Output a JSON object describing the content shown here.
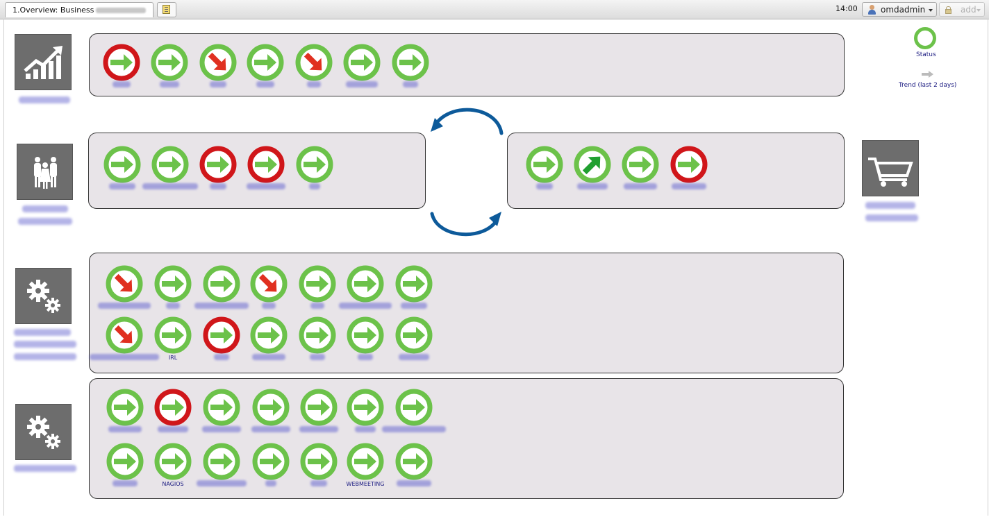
{
  "topbar": {
    "tab_label": "1.Overview: Business",
    "clock": "14:00",
    "user": "omdadmin",
    "add_label": "add"
  },
  "legend": {
    "status_label": "Status",
    "trend_label": "Trend (last 2 days)"
  },
  "colors": {
    "ok": "#6cc24a",
    "critical": "#d0161a",
    "trend_flat": "#6cc24a",
    "trend_down": "#e03020",
    "trend_up": "#20a030"
  },
  "panels": [
    {
      "name": "panel-1",
      "nodes": [
        {
          "status": "critical",
          "trend": "flat"
        },
        {
          "status": "ok",
          "trend": "flat"
        },
        {
          "status": "ok",
          "trend": "down"
        },
        {
          "status": "ok",
          "trend": "flat"
        },
        {
          "status": "ok",
          "trend": "down"
        },
        {
          "status": "ok",
          "trend": "flat"
        },
        {
          "status": "ok",
          "trend": "flat"
        }
      ]
    },
    {
      "name": "panel-2",
      "nodes": [
        {
          "status": "ok",
          "trend": "flat"
        },
        {
          "status": "ok",
          "trend": "flat"
        },
        {
          "status": "critical",
          "trend": "flat"
        },
        {
          "status": "critical",
          "trend": "flat"
        },
        {
          "status": "ok",
          "trend": "flat"
        }
      ]
    },
    {
      "name": "panel-3",
      "nodes": [
        {
          "status": "ok",
          "trend": "flat"
        },
        {
          "status": "ok",
          "trend": "up"
        },
        {
          "status": "ok",
          "trend": "flat"
        },
        {
          "status": "critical",
          "trend": "flat"
        }
      ]
    },
    {
      "name": "panel-4",
      "nodes": [
        {
          "status": "ok",
          "trend": "down",
          "label": ""
        },
        {
          "status": "ok",
          "trend": "flat",
          "label": ""
        },
        {
          "status": "ok",
          "trend": "flat",
          "label": ""
        },
        {
          "status": "ok",
          "trend": "down",
          "label": ""
        },
        {
          "status": "ok",
          "trend": "flat",
          "label": ""
        },
        {
          "status": "ok",
          "trend": "flat",
          "label": ""
        },
        {
          "status": "ok",
          "trend": "flat",
          "label": ""
        },
        {
          "status": "ok",
          "trend": "down",
          "label": ""
        },
        {
          "status": "ok",
          "trend": "flat",
          "label": "IRL"
        },
        {
          "status": "critical",
          "trend": "flat",
          "label": ""
        },
        {
          "status": "ok",
          "trend": "flat",
          "label": ""
        },
        {
          "status": "ok",
          "trend": "flat",
          "label": ""
        },
        {
          "status": "ok",
          "trend": "flat",
          "label": ""
        },
        {
          "status": "ok",
          "trend": "flat",
          "label": ""
        }
      ]
    },
    {
      "name": "panel-5",
      "nodes": [
        {
          "status": "ok",
          "trend": "flat",
          "label": ""
        },
        {
          "status": "critical",
          "trend": "flat",
          "label": ""
        },
        {
          "status": "ok",
          "trend": "flat",
          "label": ""
        },
        {
          "status": "ok",
          "trend": "flat",
          "label": ""
        },
        {
          "status": "ok",
          "trend": "flat",
          "label": ""
        },
        {
          "status": "ok",
          "trend": "flat",
          "label": ""
        },
        {
          "status": "ok",
          "trend": "flat",
          "label": ""
        },
        {
          "status": "ok",
          "trend": "flat",
          "label": ""
        },
        {
          "status": "ok",
          "trend": "flat",
          "label": "NAGIOS"
        },
        {
          "status": "ok",
          "trend": "flat",
          "label": ""
        },
        {
          "status": "ok",
          "trend": "flat",
          "label": ""
        },
        {
          "status": "ok",
          "trend": "flat",
          "label": ""
        },
        {
          "status": "ok",
          "trend": "flat",
          "label": "WEBMEETING"
        },
        {
          "status": "ok",
          "trend": "flat",
          "label": ""
        }
      ]
    }
  ],
  "side_icons": [
    {
      "name": "chart-growth-icon"
    },
    {
      "name": "people-icon"
    },
    {
      "name": "shopping-cart-icon"
    },
    {
      "name": "gears-icon"
    },
    {
      "name": "gears-icon"
    }
  ]
}
